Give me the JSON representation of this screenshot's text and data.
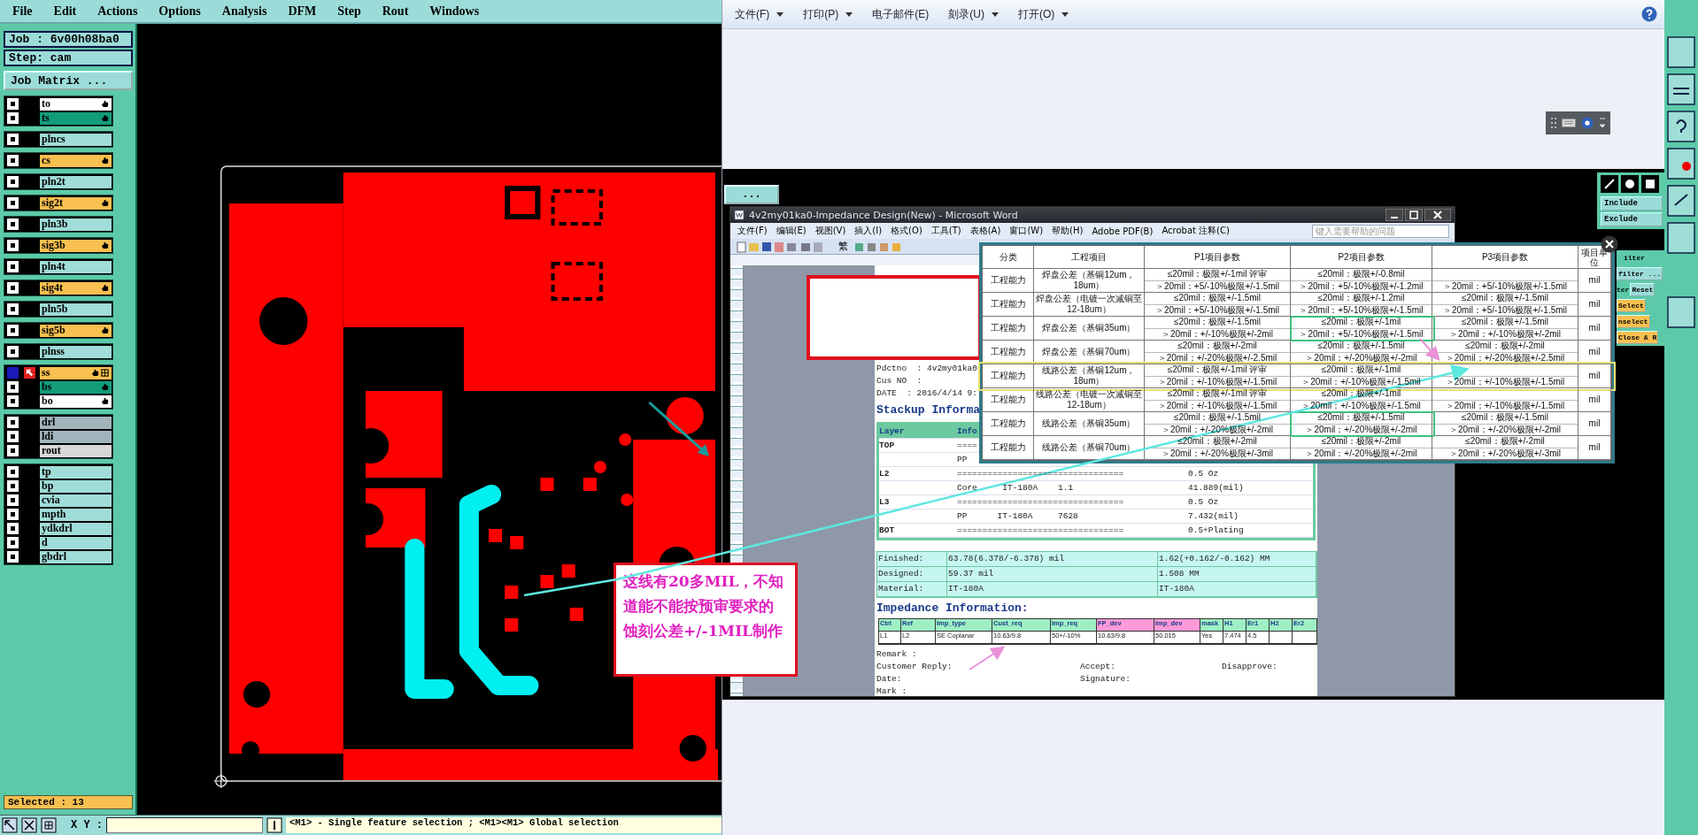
{
  "cam_menu": [
    "File",
    "Edit",
    "Actions",
    "Options",
    "Analysis",
    "DFM",
    "Step",
    "Rout",
    "Windows"
  ],
  "job_panel": {
    "job": "Job : 6v00h08ba0",
    "step": "Step: cam",
    "matrix_button": "Job Matrix ..."
  },
  "layer_groups": [
    {
      "layers": [
        {
          "name": "to",
          "color": "#ffffff",
          "affected": true,
          "selected": false
        },
        {
          "name": "ts",
          "color": "#129c7a",
          "affected": true,
          "selected": false
        }
      ]
    },
    {
      "layers": [
        {
          "name": "plncs",
          "color": "#a0dcd8",
          "affected": false,
          "selected": false
        }
      ]
    },
    {
      "layers": [
        {
          "name": "cs",
          "color": "#f8c050",
          "affected": true,
          "selected": false
        }
      ]
    },
    {
      "layers": [
        {
          "name": "pln2t",
          "color": "#a0dcd8",
          "affected": false,
          "selected": false
        }
      ]
    },
    {
      "layers": [
        {
          "name": "sig2t",
          "color": "#f8c050",
          "affected": true,
          "selected": false
        }
      ]
    },
    {
      "layers": [
        {
          "name": "pln3b",
          "color": "#a0dcd8",
          "affected": false,
          "selected": false
        }
      ]
    },
    {
      "layers": [
        {
          "name": "sig3b",
          "color": "#f8c050",
          "affected": true,
          "selected": false
        }
      ]
    },
    {
      "layers": [
        {
          "name": "pln4t",
          "color": "#a0dcd8",
          "affected": false,
          "selected": false
        }
      ]
    },
    {
      "layers": [
        {
          "name": "sig4t",
          "color": "#f8c050",
          "affected": true,
          "selected": false
        }
      ]
    },
    {
      "layers": [
        {
          "name": "pln5b",
          "color": "#a0dcd8",
          "affected": false,
          "selected": false
        }
      ]
    },
    {
      "layers": [
        {
          "name": "sig5b",
          "color": "#f8c050",
          "affected": true,
          "selected": false
        }
      ]
    },
    {
      "layers": [
        {
          "name": "plnss",
          "color": "#a0dcd8",
          "affected": false,
          "selected": false
        }
      ]
    },
    {
      "layers": [
        {
          "name": "ss",
          "color": "#f8c050",
          "affected": true,
          "selected": true
        },
        {
          "name": "bs",
          "color": "#129c7a",
          "affected": true,
          "selected": false
        },
        {
          "name": "bo",
          "color": "#ffffff",
          "affected": true,
          "selected": false
        }
      ]
    },
    {
      "layers": [
        {
          "name": "drl",
          "color": "#a2b4bc",
          "affected": false,
          "selected": false
        },
        {
          "name": "ldi",
          "color": "#a2b4bc",
          "affected": false,
          "selected": false
        },
        {
          "name": "rout",
          "color": "#d8d8d8",
          "affected": false,
          "selected": false
        }
      ]
    },
    {
      "layers": [
        {
          "name": "tp",
          "color": "#a0dcd8",
          "affected": false,
          "selected": false
        },
        {
          "name": "bp",
          "color": "#a0dcd8",
          "affected": false,
          "selected": false
        },
        {
          "name": "cvia",
          "color": "#a0dcd8",
          "affected": false,
          "selected": false
        },
        {
          "name": "mpth",
          "color": "#a0dcd8",
          "affected": false,
          "selected": false
        },
        {
          "name": "ydkdrl",
          "color": "#a0dcd8",
          "affected": false,
          "selected": false
        },
        {
          "name": "d",
          "color": "#a0dcd8",
          "affected": false,
          "selected": false
        },
        {
          "name": "gbdrl",
          "color": "#a0dcd8",
          "affected": false,
          "selected": false
        }
      ]
    }
  ],
  "selected_count": "Selected : 13",
  "status_bar": {
    "coord_label": "X Y :",
    "message": "<M1> - Single feature selection ; <M1><M1> Global selection"
  },
  "annotation": "这线有20多MIL，不知道能不能按预审要求的蚀刻公差+/-1MIL制作",
  "viewer_menu": [
    {
      "label": "文件(F)",
      "dropdown": true
    },
    {
      "label": "打印(P)",
      "dropdown": true
    },
    {
      "label": "电子邮件(E)",
      "dropdown": false
    },
    {
      "label": "刻录(U)",
      "dropdown": true
    },
    {
      "label": "打开(O)",
      "dropdown": true
    }
  ],
  "screenshot": {
    "more_button": "...",
    "cam_tools_top": [
      "Include",
      "Exclude"
    ],
    "cam_tools_side": {
      "filter_label": "ilter",
      "filter_button": "filter ...",
      "reset_label": "ter",
      "reset_button": "Reset",
      "buttons": [
        "Select",
        "nselect",
        "Close & R"
      ]
    },
    "word": {
      "title": "4v2my01ka0-Impedance Design(New) - Microsoft Word",
      "menu": [
        "文件(F)",
        "编辑(E)",
        "视图(V)",
        "插入(I)",
        "格式(O)",
        "工具(T)",
        "表格(A)",
        "窗口(W)",
        "帮助(H)",
        "Adobe PDF(B)",
        "Acrobat 注释(C)"
      ],
      "help_placeholder": "键入需要帮助的问题",
      "toolbar_glyph": "繁",
      "page": {
        "header_lines": [
          "Pdctno  : 4v2my01ka0",
          "Cus NO  :",
          "DATE  : 2016/4/14 9:"
        ],
        "stackup_title": "Stackup Informa",
        "stackup_header": [
          "Layer",
          "Info"
        ],
        "stackup_rows": [
          {
            "layer": "TOP",
            "info": "===="
          },
          {
            "info": "PP"
          },
          {
            "layer": "L2",
            "info": "=================================",
            "value": "0.5 Oz"
          },
          {
            "info": "Core     IT-180A    1.1",
            "value": "41.889(mil)"
          },
          {
            "layer": "L3",
            "info": "=================================",
            "value": "0.5 Oz"
          },
          {
            "info": "PP      IT-180A     7628",
            "value": "7.432(mil)"
          },
          {
            "layer": "BOT",
            "info": "=================================",
            "value": "0.5+Plating"
          }
        ],
        "summary_rows": [
          [
            "Finished:",
            "63.78(6.378/-6.378) mil",
            "1.62(+0.162/-0.162) MM"
          ],
          [
            "Designed:",
            "59.37 mil",
            "1.508 MM"
          ],
          [
            "Material:",
            "IT-180A",
            "IT-180A"
          ]
        ],
        "impedance_title": "Impedance Information:",
        "impedance_columns": [
          {
            "label": "Ctrl",
            "kind": "plain"
          },
          {
            "label": "Ref",
            "kind": "plain"
          },
          {
            "label": "Imp_type",
            "kind": "plain"
          },
          {
            "label": "Cust_req",
            "kind": "plain"
          },
          {
            "label": "Imp_req",
            "kind": "plain"
          },
          {
            "label": "FP_dev",
            "kind": "calc"
          },
          {
            "label": "Imp_dev",
            "kind": "calc"
          },
          {
            "label": "mask",
            "kind": "plain"
          },
          {
            "label": "H1",
            "kind": "plain"
          },
          {
            "label": "Er1",
            "kind": "plain"
          },
          {
            "label": "H2",
            "kind": "plain"
          },
          {
            "label": "Er2",
            "kind": "plain"
          }
        ],
        "impedance_row": [
          "L1",
          "L2",
          "SE Coplanar",
          "10.63/9.8",
          "50+/-10%",
          "10.63/9.8",
          "50.015",
          "Yes",
          "7.474",
          "4.5"
        ],
        "remark": "Remark :",
        "footer_rows": [
          [
            "Customer Reply:",
            "Accept:",
            "Disapprove:"
          ],
          [
            "Date:",
            "Signature:"
          ]
        ],
        "mark": "Mark :"
      }
    },
    "tolerance_table": {
      "columns": [
        "分类",
        "工程项目",
        "P1项目参数",
        "P2项目参数",
        "P3项目参数",
        "项目单位"
      ],
      "rows": [
        {
          "category": "工程能力",
          "item": "焊盘公差（基铜12um，18um）",
          "p1": {
            "le": "≤20mil：极限+/-1mil 评审",
            "gt": "＞20mil：+5/-10%极限+/-1.5mil"
          },
          "p2": {
            "le": "≤20mil：极限+/-0.8mil",
            "gt": "＞20mil：+5/-10%极限+/-1.2mil"
          },
          "p3": {
            "gt": "＞20mil：+5/-10%极限+/-1.5mil"
          },
          "unit": "mil",
          "row_frame": false,
          "p2_frame": false
        },
        {
          "category": "工程能力",
          "item": "焊盘公差（电镀一次减铜至12-18um）",
          "p1": {
            "le": "≤20mil：极限+/-1.5mil",
            "gt": "＞20mil：+5/-10%极限+/-1.5mil"
          },
          "p2": {
            "le": "≤20mil：极限+/-1.2mil",
            "gt": "＞20mil：+5/-10%极限+/-1.5mil"
          },
          "p3": {
            "le": "≤20mil：极限+/-1.5mil",
            "gt": "＞20mil：+5/-10%极限+/-1.5mil"
          },
          "unit": "mil",
          "row_frame": false,
          "p2_frame": false
        },
        {
          "category": "工程能力",
          "item": "焊盘公差（基铜35um）",
          "p1": {
            "le": "≤20mil：极限+/-1.5mil",
            "gt": "＞20mil：+/-10%极限+/-2mil"
          },
          "p2": {
            "le": "≤20mil：极限+/-1mil",
            "gt": "＞20mil：+5/-10%极限+/-1.5mil"
          },
          "p3": {
            "le": "≤20mil：极限+/-1.5mil",
            "gt": "＞20mil：+/-10%极限+/-2mil"
          },
          "unit": "mil",
          "row_frame": false,
          "p2_frame": true
        },
        {
          "category": "工程能力",
          "item": "焊盘公差（基铜70um）",
          "p1": {
            "le": "≤20mil：极限+/-2mil",
            "gt": "＞20mil：+/-20%极限+/-2.5mil"
          },
          "p2": {
            "le": "≤20mil：极限+/-1.5mil",
            "gt": "＞20mil：+/-20%极限+/-2mil"
          },
          "p3": {
            "le": "≤20mil：极限+/-2mil",
            "gt": "＞20mil：+/-20%极限+/-2.5mil"
          },
          "unit": "mil",
          "row_frame": false,
          "p2_frame": false
        },
        {
          "category": "工程能力",
          "item": "线路公差（基铜12um，18um）",
          "p1": {
            "le": "≤20mil：极限+/-1mil 评审",
            "gt": "＞20mil：+/-10%极限+/-1.5mil"
          },
          "p2": {
            "le": "≤20mil：极限+/-1mil",
            "gt": "＞20mil：+/-10%极限+/-1.5mil"
          },
          "p3": {
            "gt": "＞20mil：+/-10%极限+/-1.5mil"
          },
          "unit": "mil",
          "row_frame": true,
          "p2_frame": false
        },
        {
          "category": "工程能力",
          "item": "线路公差（电镀一次减铜至12-18um）",
          "p1": {
            "le": "≤20mil：极限+/-1mil 评审",
            "gt": "＞20mil：+/-10%极限+/-1.5mil"
          },
          "p2": {
            "le": "≤20mil：极限+/-1mil",
            "gt": "＞20mil：+/-10%极限+/-1.5mil"
          },
          "p3": {
            "gt": "＞20mil：+/-10%极限+/-1.5mil"
          },
          "unit": "mil",
          "row_frame": false,
          "p2_frame": false
        },
        {
          "category": "工程能力",
          "item": "线路公差（基铜35um）",
          "p1": {
            "le": "≤20mil：极限+/-1.5mil",
            "gt": "＞20mil：+/-20%极限+/-2mil"
          },
          "p2": {
            "le": "≤20mil：极限+/-1.5mil",
            "gt": "＞20mil：+/-20%极限+/-2mil"
          },
          "p3": {
            "le": "≤20mil：极限+/-1.5mil",
            "gt": "＞20mil：+/-20%极限+/-2mil"
          },
          "unit": "mil",
          "row_frame": false,
          "p2_frame": true
        },
        {
          "category": "工程能力",
          "item": "线路公差（基铜70um）",
          "p1": {
            "le": "≤20mil：极限+/-2mil",
            "gt": "＞20mil：+/-20%极限+/-3mil"
          },
          "p2": {
            "le": "≤20mil：极限+/-2mil",
            "gt": "＞20mil：+/-20%极限+/-2mil"
          },
          "p3": {
            "le": "≤20mil：极限+/-2mil",
            "gt": "＞20mil：+/-20%极限+/-3mil"
          },
          "unit": "mil",
          "row_frame": false,
          "p2_frame": false
        }
      ]
    }
  }
}
